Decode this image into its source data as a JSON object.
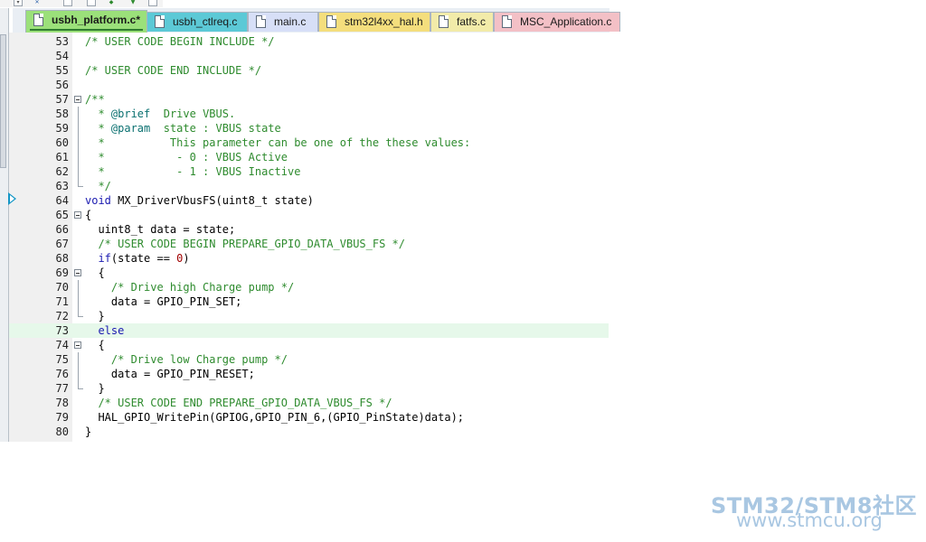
{
  "toolbar": {
    "buttons": [
      {
        "icon": "dropdown-icon"
      },
      {
        "icon": "build-icon"
      },
      {
        "icon": "window-icon"
      },
      {
        "icon": "page-icon"
      },
      {
        "icon": "diamond-icon"
      },
      {
        "icon": "download-icon"
      },
      {
        "icon": "debug-icon"
      }
    ]
  },
  "tabs": [
    {
      "label": "usbh_platform.c*",
      "active": true,
      "color": "#9be07a"
    },
    {
      "label": "usbh_ctlreq.c",
      "active": false,
      "color": "#5cc9d6"
    },
    {
      "label": "main.c",
      "active": false,
      "color": "#d7dff7"
    },
    {
      "label": "stm32l4xx_hal.h",
      "active": false,
      "color": "#f4de7d"
    },
    {
      "label": "fatfs.c",
      "active": false,
      "color": "#f2eba9"
    },
    {
      "label": "MSC_Application.c",
      "active": false,
      "color": "#f3c0c6"
    }
  ],
  "editor": {
    "current_line": "64",
    "lines": [
      {
        "n": "53",
        "text": "/* USER CODE BEGIN INCLUDE */"
      },
      {
        "n": "54",
        "text": ""
      },
      {
        "n": "55",
        "text": "/* USER CODE END INCLUDE */"
      },
      {
        "n": "56",
        "text": ""
      },
      {
        "n": "57",
        "text": "/**"
      },
      {
        "n": "58",
        "text": "  * @brief  Drive VBUS."
      },
      {
        "n": "59",
        "text": "  * @param  state : VBUS state"
      },
      {
        "n": "60",
        "text": "  *          This parameter can be one of the these values:"
      },
      {
        "n": "61",
        "text": "  *           - 0 : VBUS Active"
      },
      {
        "n": "62",
        "text": "  *           - 1 : VBUS Inactive"
      },
      {
        "n": "63",
        "text": "  */"
      },
      {
        "n": "64",
        "text": "void MX_DriverVbusFS(uint8_t state)"
      },
      {
        "n": "65",
        "text": "{"
      },
      {
        "n": "66",
        "text": "  uint8_t data = state;"
      },
      {
        "n": "67",
        "text": "  /* USER CODE BEGIN PREPARE_GPIO_DATA_VBUS_FS */"
      },
      {
        "n": "68",
        "text": "  if(state == 0)"
      },
      {
        "n": "69",
        "text": "  {"
      },
      {
        "n": "70",
        "text": "    /* Drive high Charge pump */"
      },
      {
        "n": "71",
        "text": "    data = GPIO_PIN_SET;"
      },
      {
        "n": "72",
        "text": "  }"
      },
      {
        "n": "73",
        "text": "  else"
      },
      {
        "n": "74",
        "text": "  {"
      },
      {
        "n": "75",
        "text": "    /* Drive low Charge pump */"
      },
      {
        "n": "76",
        "text": "    data = GPIO_PIN_RESET;"
      },
      {
        "n": "77",
        "text": "  }"
      },
      {
        "n": "78",
        "text": "  /* USER CODE END PREPARE_GPIO_DATA_VBUS_FS */"
      },
      {
        "n": "79",
        "text": "  HAL_GPIO_WritePin(GPIOG,GPIO_PIN_6,(GPIO_PinState)data);"
      },
      {
        "n": "80",
        "text": "}"
      }
    ]
  },
  "watermark": {
    "line1": "STM32/STM8社区",
    "line2": "www.stmcu.org"
  },
  "colors": {
    "comment": "#2e8b2e",
    "keyword": "#1a1ab0",
    "highlight_line": "#e6f8ea",
    "watermark": "#a9c7e2"
  }
}
